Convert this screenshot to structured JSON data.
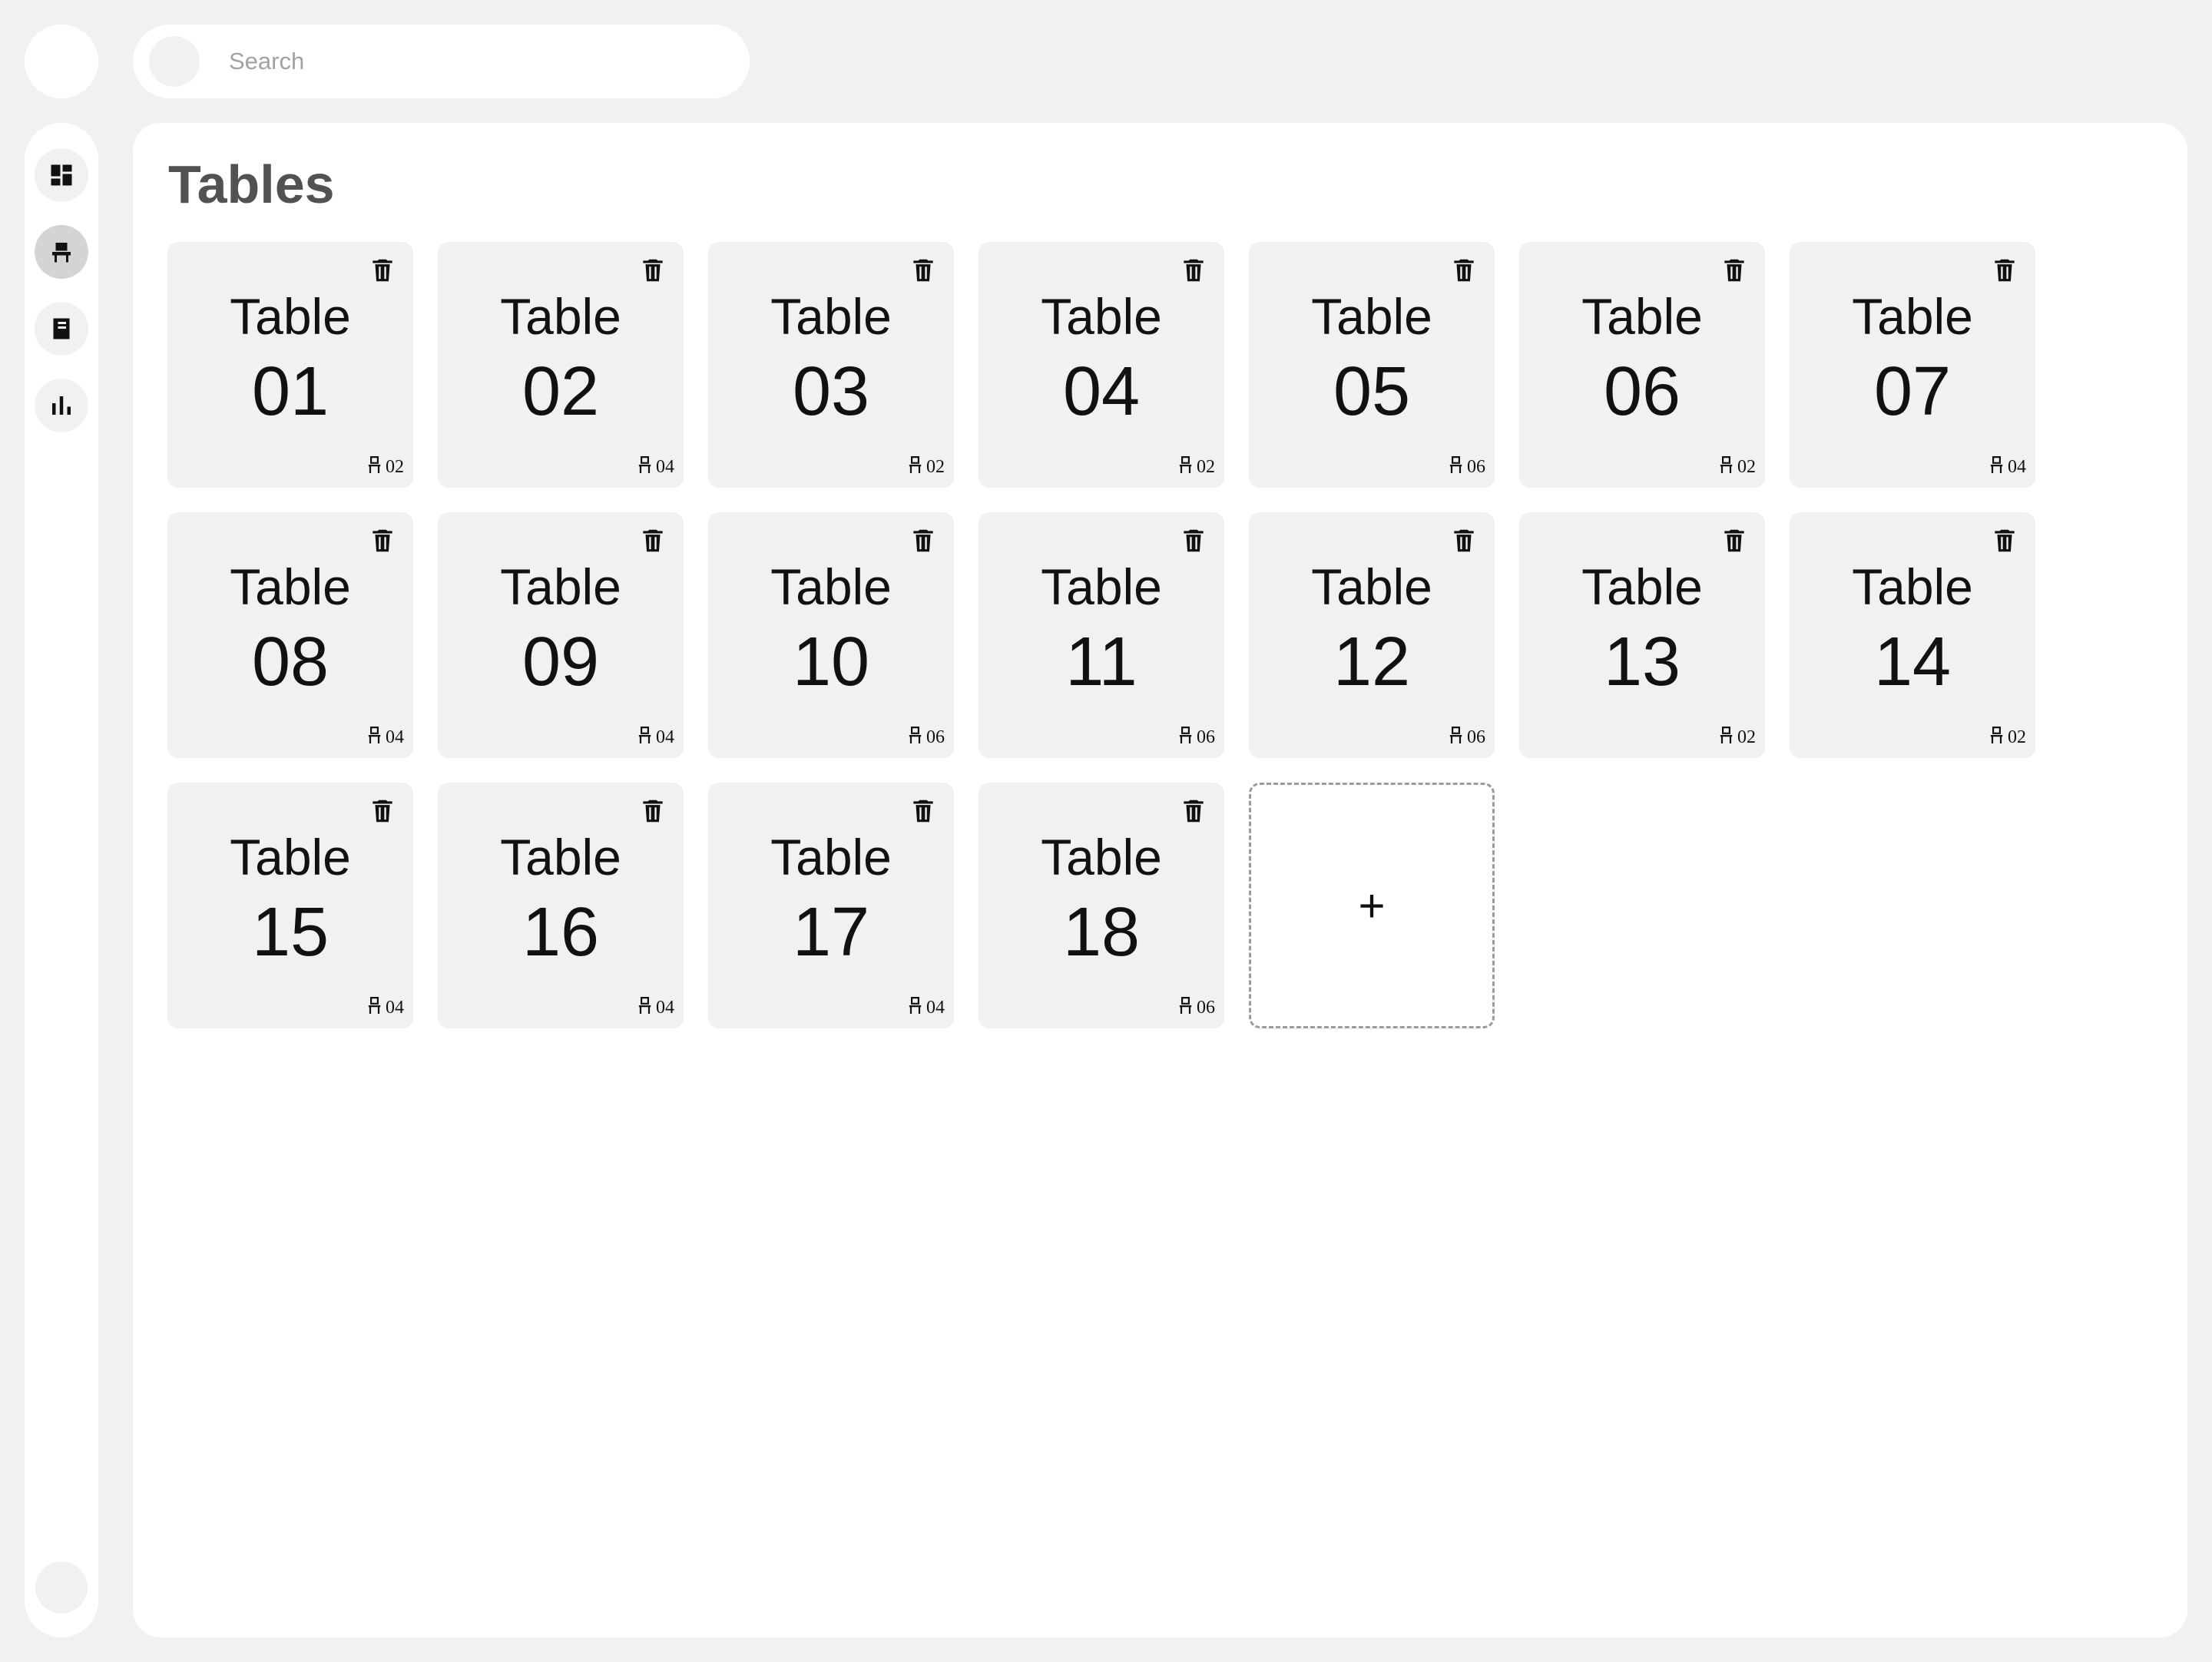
{
  "search": {
    "placeholder": "Search",
    "value": ""
  },
  "nav": {
    "items": [
      {
        "id": "dashboard",
        "icon": "dashboard-icon",
        "active": false
      },
      {
        "id": "tables",
        "icon": "chair-icon",
        "active": true
      },
      {
        "id": "menu",
        "icon": "book-icon",
        "active": false
      },
      {
        "id": "reports",
        "icon": "bar-chart-icon",
        "active": false
      }
    ]
  },
  "page": {
    "title": "Tables"
  },
  "tables": [
    {
      "word": "Table",
      "number": "01",
      "seats": "02"
    },
    {
      "word": "Table",
      "number": "02",
      "seats": "04"
    },
    {
      "word": "Table",
      "number": "03",
      "seats": "02"
    },
    {
      "word": "Table",
      "number": "04",
      "seats": "02"
    },
    {
      "word": "Table",
      "number": "05",
      "seats": "06"
    },
    {
      "word": "Table",
      "number": "06",
      "seats": "02"
    },
    {
      "word": "Table",
      "number": "07",
      "seats": "04"
    },
    {
      "word": "Table",
      "number": "08",
      "seats": "04"
    },
    {
      "word": "Table",
      "number": "09",
      "seats": "04"
    },
    {
      "word": "Table",
      "number": "10",
      "seats": "06"
    },
    {
      "word": "Table",
      "number": "11",
      "seats": "06"
    },
    {
      "word": "Table",
      "number": "12",
      "seats": "06"
    },
    {
      "word": "Table",
      "number": "13",
      "seats": "02"
    },
    {
      "word": "Table",
      "number": "14",
      "seats": "02"
    },
    {
      "word": "Table",
      "number": "15",
      "seats": "04"
    },
    {
      "word": "Table",
      "number": "16",
      "seats": "04"
    },
    {
      "word": "Table",
      "number": "17",
      "seats": "04"
    },
    {
      "word": "Table",
      "number": "18",
      "seats": "06"
    }
  ],
  "add_button": {
    "label": "+"
  },
  "icons": {
    "delete": "trash-icon",
    "seats": "chair-icon"
  }
}
